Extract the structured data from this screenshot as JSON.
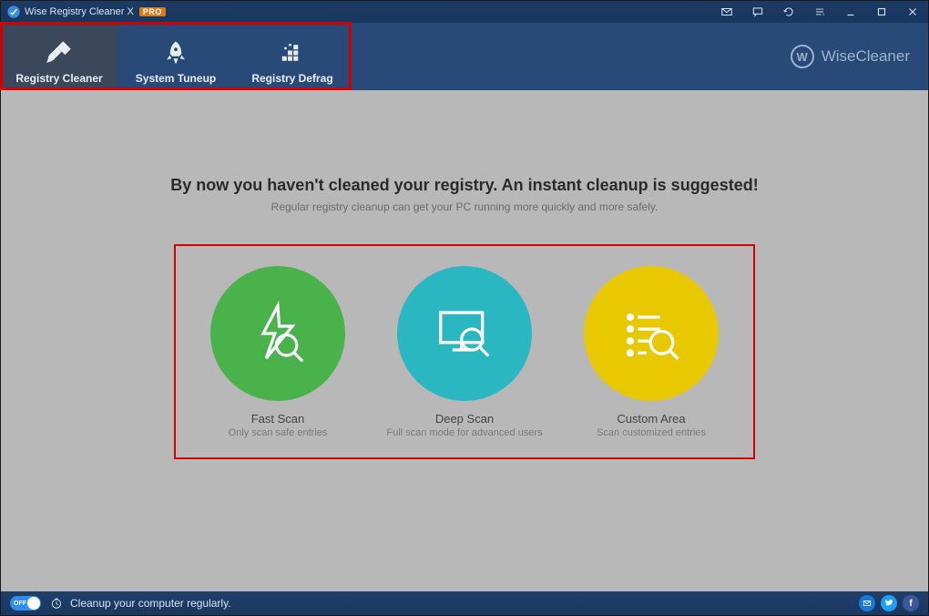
{
  "title": {
    "app_name": "Wise Registry Cleaner X",
    "pro": "PRO"
  },
  "brand": "WiseCleaner",
  "tabs": [
    {
      "label": "Registry Cleaner"
    },
    {
      "label": "System Tuneup"
    },
    {
      "label": "Registry Defrag"
    }
  ],
  "main": {
    "headline": "By now you haven't cleaned your registry. An instant cleanup is suggested!",
    "subline": "Regular registry cleanup can get your PC running more quickly and more safely."
  },
  "options": [
    {
      "title": "Fast Scan",
      "desc": "Only scan safe entries"
    },
    {
      "title": "Deep Scan",
      "desc": "Full scan mode for advanced users"
    },
    {
      "title": "Custom Area",
      "desc": "Scan customized entries"
    }
  ],
  "status": {
    "toggle_label": "OFF",
    "message": "Cleanup your computer regularly."
  }
}
